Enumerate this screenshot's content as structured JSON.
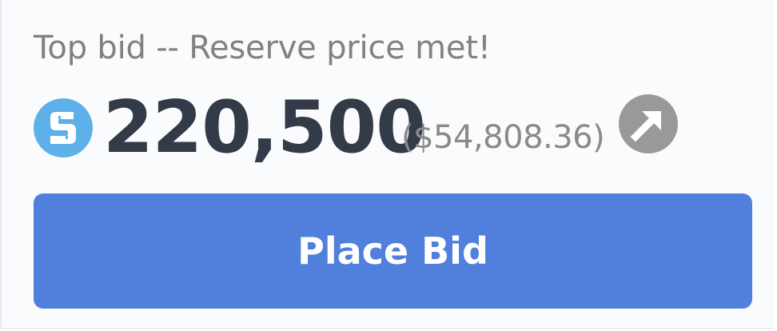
{
  "bid": {
    "status_text": "Top bid -- Reserve price met!",
    "currency_icon": "sand-coin-icon",
    "amount": "220,500",
    "fiat_value": "($54,808.36)",
    "link_icon": "external-link-arrow-icon"
  },
  "actions": {
    "place_bid_label": "Place Bid"
  },
  "colors": {
    "coin": "#5eb1e8",
    "amount_text": "#333b49",
    "muted_text": "#818181",
    "link_icon_bg": "#999999",
    "button_bg": "#507fdc",
    "button_text": "#ffffff"
  }
}
